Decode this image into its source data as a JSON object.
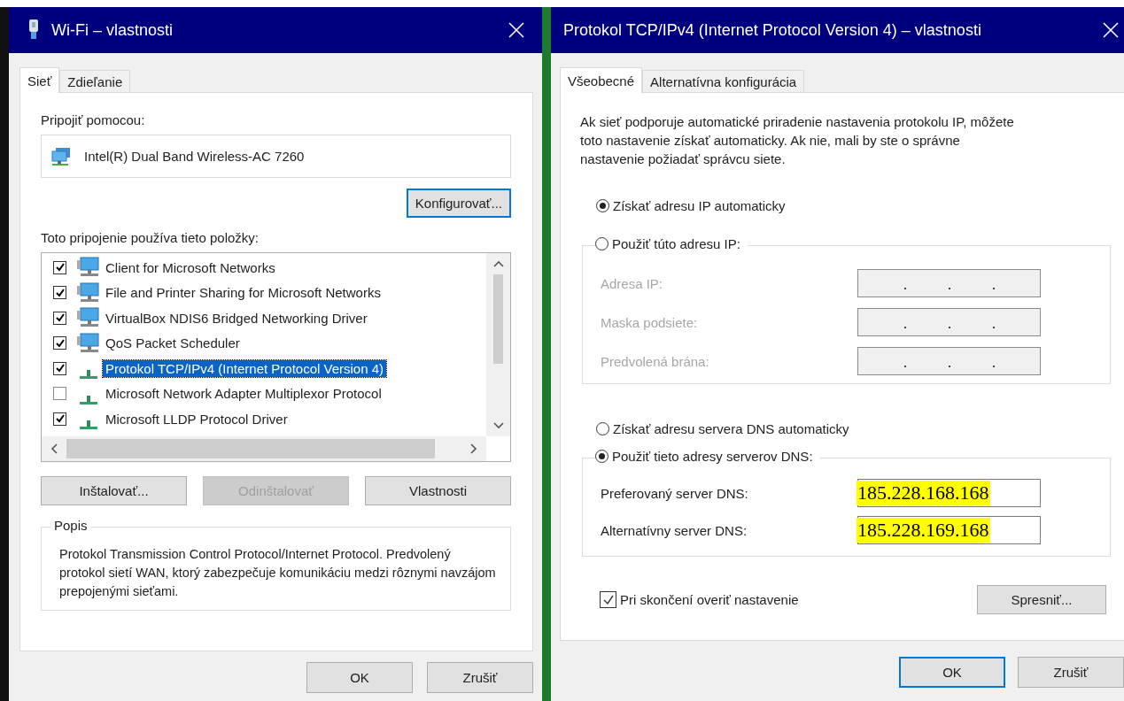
{
  "wifi_dialog": {
    "title": "Wi-Fi – vlastnosti",
    "tabs": [
      {
        "label": "Sieť",
        "selected": true
      },
      {
        "label": "Zdieľanie",
        "selected": false
      }
    ],
    "connect_label": "Pripojiť pomocou:",
    "adapter": "Intel(R) Dual Band Wireless-AC 7260",
    "configure_button": "Konfigurovať...",
    "items_label": "Toto pripojenie používa tieto položky:",
    "items": [
      {
        "label": "Client for Microsoft Networks",
        "checked": true,
        "selected": false,
        "kind": "client"
      },
      {
        "label": "File and Printer Sharing for Microsoft Networks",
        "checked": true,
        "selected": false,
        "kind": "client"
      },
      {
        "label": "VirtualBox NDIS6 Bridged Networking Driver",
        "checked": true,
        "selected": false,
        "kind": "client"
      },
      {
        "label": "QoS Packet Scheduler",
        "checked": true,
        "selected": false,
        "kind": "client"
      },
      {
        "label": "Protokol TCP/IPv4 (Internet Protocol Version 4)",
        "checked": true,
        "selected": true,
        "kind": "protocol"
      },
      {
        "label": "Microsoft Network Adapter Multiplexor Protocol",
        "checked": false,
        "selected": false,
        "kind": "protocol"
      },
      {
        "label": "Microsoft LLDP Protocol Driver",
        "checked": true,
        "selected": false,
        "kind": "protocol"
      }
    ],
    "buttons": [
      {
        "label": "Inštalovať...",
        "disabled": false
      },
      {
        "label": "Odinštalovať",
        "disabled": true
      },
      {
        "label": "Vlastnosti",
        "disabled": false
      }
    ],
    "description": {
      "title": "Popis",
      "text": "Protokol Transmission Control Protocol/Internet Protocol. Predvolený protokol sietí WAN, ktorý zabezpečuje komunikáciu medzi rôznymi navzájom prepojenými sieťami."
    },
    "footer_buttons": [
      {
        "label": "OK",
        "default": false
      },
      {
        "label": "Zrušiť",
        "default": false
      }
    ]
  },
  "ipv4_dialog": {
    "title": "Protokol TCP/IPv4 (Internet Protocol Version 4) – vlastnosti",
    "tabs": [
      {
        "label": "Všeobecné",
        "selected": true
      },
      {
        "label": "Alternatívna konfigurácia",
        "selected": false
      }
    ],
    "intro": "Ak sieť podporuje automatické priradenie nastavenia protokolu IP, môžete toto nastavenie získať automaticky. Ak nie, mali by ste o správne nastavenie požiadať správcu siete.",
    "ip_options": [
      {
        "label": "Získať adresu IP automaticky",
        "selected": true
      },
      {
        "label": "Použiť túto adresu IP:",
        "selected": false
      }
    ],
    "ip_fields": [
      {
        "label": "Adresa IP:",
        "disabled": true
      },
      {
        "label": "Maska podsiete:",
        "disabled": true
      },
      {
        "label": "Predvolená brána:",
        "disabled": true
      }
    ],
    "dns_options": [
      {
        "label": "Získať adresu servera DNS automaticky",
        "selected": false
      },
      {
        "label": "Použiť tieto adresy serverov DNS:",
        "selected": true
      }
    ],
    "dns_fields": [
      {
        "label": "Preferovaný server DNS:",
        "value": "185.228.168.168",
        "highlighted": true
      },
      {
        "label": "Alternatívny server DNS:",
        "value": "185.228.169.168",
        "highlighted": true
      }
    ],
    "validate": {
      "label": "Pri skončení overiť nastavenie",
      "checked": true
    },
    "advanced_button": "Spresniť...",
    "footer_buttons": [
      {
        "label": "OK",
        "default": true
      },
      {
        "label": "Zrušiť",
        "default": false
      }
    ]
  }
}
